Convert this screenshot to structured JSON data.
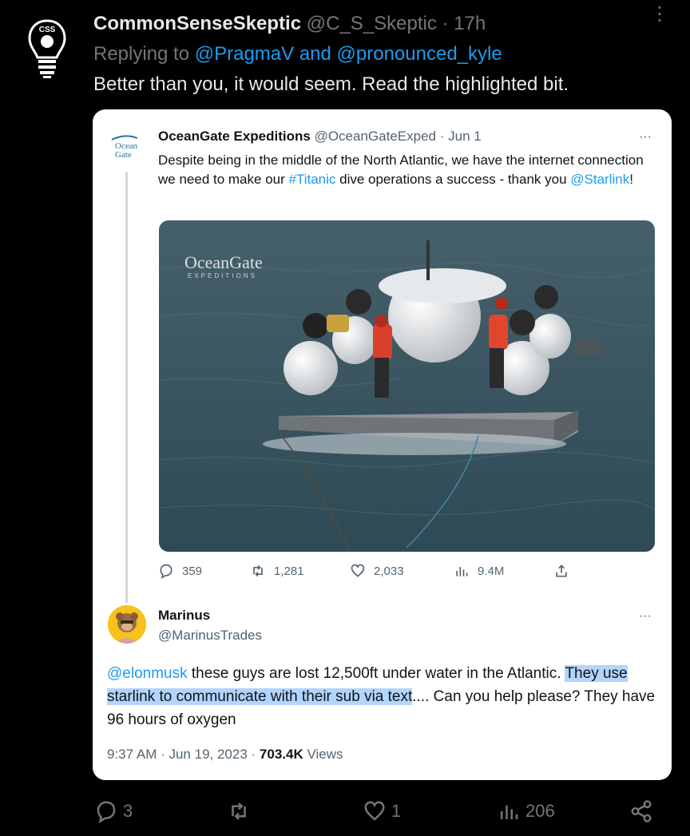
{
  "reply": {
    "author_name": "CommonSenseSkeptic",
    "author_handle": "@C_S_Skeptic",
    "dot": "·",
    "time": "17h",
    "replying_prefix": "Replying to",
    "replying_to": "@PragmaV and @pronounced_kyle",
    "text": "Better than you, it would seem. Read the highlighted bit.",
    "avatar_label": "CSS",
    "more_glyph": "⋮"
  },
  "quoted": {
    "author_name": "OceanGate Expeditions",
    "author_handle": "@OceanGateExped",
    "date": "Jun 1",
    "logo_text_1": "Ocean",
    "logo_text_2": "Gate",
    "more_glyph": "···",
    "text_1": "Despite being in the middle of the North Atlantic, we have the internet connection we need to make our ",
    "hashtag": "#Titanic",
    "text_2": " dive operations a success - thank you ",
    "mention": "@Starlink",
    "text_3": "!",
    "media_watermark_1": "OceanGate",
    "media_watermark_2": "EXPEDITIONS",
    "stats": {
      "replies": "359",
      "retweets": "1,281",
      "likes": "2,033",
      "views": "9.4M"
    }
  },
  "marinus": {
    "name": "Marinus",
    "handle": "@MarinusTrades",
    "more_glyph": "···",
    "mention": "@elonmusk",
    "text_1": " these guys are lost 12,500ft under water in the Atlantic. ",
    "highlighted": "They use starlink to communicate with their sub via text",
    "text_2": ".... Can you help please? They have 96 hours of oxygen",
    "timestamp": "9:37 AM · Jun 19, 2023 · ",
    "views_count": "703.4K",
    "views_label": " Views"
  },
  "bottom_actions": {
    "replies": "3",
    "likes": "1",
    "views": "206"
  },
  "colors": {
    "background": "#000000",
    "link": "#1d9bf0",
    "muted": "#71767b",
    "highlight": "#b3d4fc"
  }
}
